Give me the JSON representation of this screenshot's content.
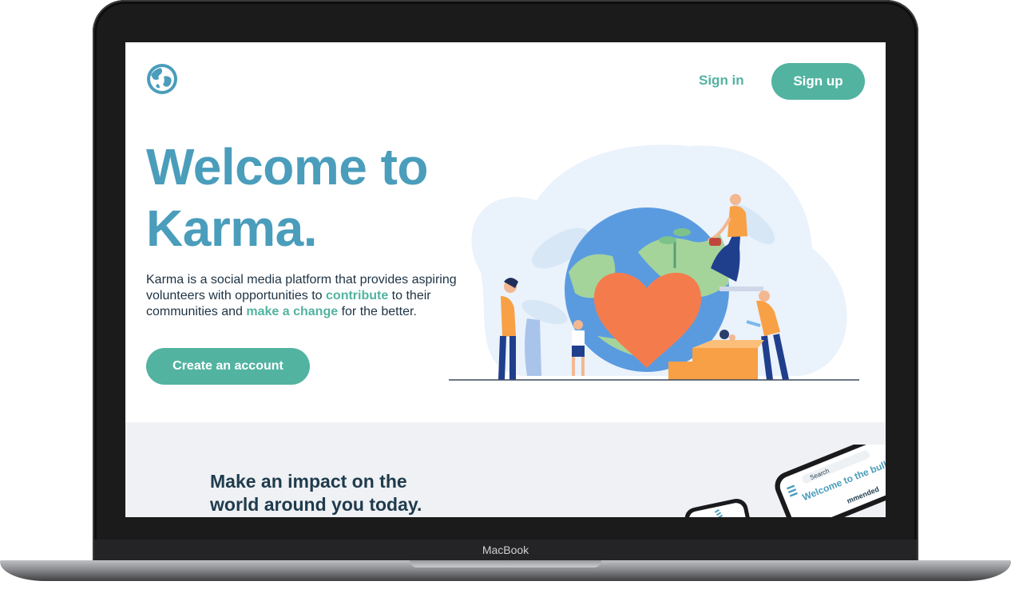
{
  "device": {
    "brand_label": "MacBook"
  },
  "header": {
    "logo_icon": "globe-icon",
    "signin_label": "Sign in",
    "signup_label": "Sign up"
  },
  "hero": {
    "title_line1": "Welcome to",
    "title_line2": "Karma.",
    "desc_part1": "Karma is a social media platform that provides aspiring volunteers with opportunities to ",
    "desc_highlight1": "contribute",
    "desc_part2": " to their communities and ",
    "desc_highlight2": "make a change",
    "desc_part3": " for the better.",
    "cta_label": "Create an account"
  },
  "section2": {
    "title_line1": "Make an impact on the",
    "title_line2": "world around you today.",
    "phone_search": "Search",
    "phone_heading": "Welcome to the bulletin board.",
    "phone_recommended": "mmended"
  },
  "colors": {
    "accent": "#52b3a1",
    "title_blue": "#4a9dbb",
    "dark_text": "#1e3344",
    "section_bg": "#eff1f4"
  }
}
